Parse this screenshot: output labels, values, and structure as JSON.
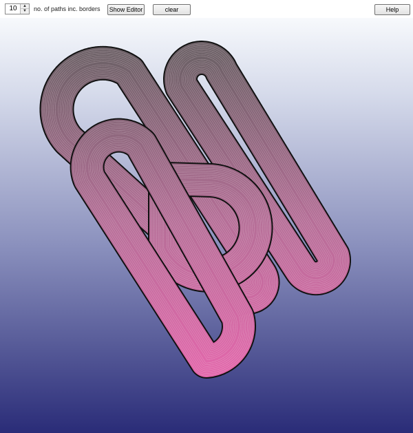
{
  "toolbar": {
    "paths_count_value": "10",
    "paths_count_label": "no. of paths inc. borders",
    "show_editor_label": "Show Editor",
    "clear_label": "clear",
    "help_label": "Help"
  },
  "canvas": {
    "background_top_color": "#f7f9fc",
    "background_bottom_color": "#2a2c78",
    "ribbon_top_color": "#6d6167",
    "ribbon_bottom_color": "#f264b2",
    "border_color": "#111111",
    "inner_line_color": "#f2dce6"
  }
}
